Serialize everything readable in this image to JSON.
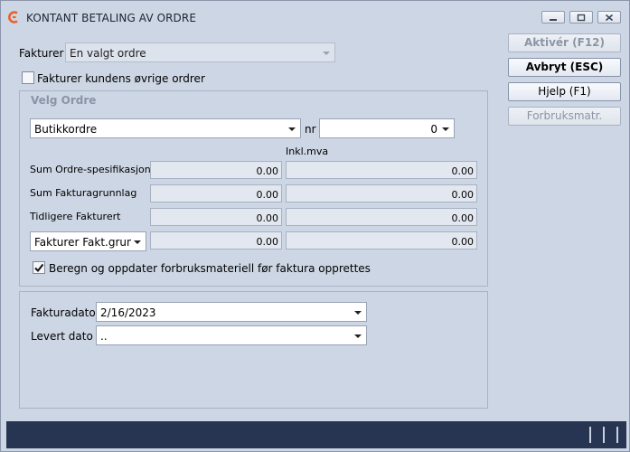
{
  "window": {
    "title": "KONTANT BETALING AV ORDRE",
    "accent_color": "#e9622a"
  },
  "fakturer": {
    "label": "Fakturer",
    "value": "En valgt ordre",
    "other_orders_label": "Fakturer kundens øvrige ordrer",
    "other_orders_checked": false
  },
  "velg_ordre": {
    "title": "Velg Ordre",
    "order_type": "Butikkordre",
    "nr_label": "nr",
    "nr_value": "0",
    "inkl_mva_label": "Inkl.mva",
    "rows": [
      {
        "label": "Sum Ordre-spesifikasjon",
        "value": "0.00",
        "value_mva": "0.00"
      },
      {
        "label": "Sum Fakturagrunnlag",
        "value": "0.00",
        "value_mva": "0.00"
      },
      {
        "label": "Tidligere Fakturert",
        "value": "0.00",
        "value_mva": "0.00"
      }
    ],
    "last_row_select": "Fakturer Fakt.grunnl",
    "last_row_value": "0.00",
    "last_row_value_mva": "0.00",
    "update_checkbox_label": "Beregn og oppdater forbruksmateriell før faktura opprettes",
    "update_checkbox_checked": true
  },
  "dates": {
    "fakturadato_label": "Fakturadato",
    "fakturadato_value": "2/16/2023",
    "levert_label": "Levert dato",
    "levert_value": ".."
  },
  "buttons": {
    "activate": "Aktivér (F12)",
    "cancel": "Avbryt (ESC)",
    "help": "Hjelp (F1)",
    "consumables": "Forbruksmatr."
  }
}
